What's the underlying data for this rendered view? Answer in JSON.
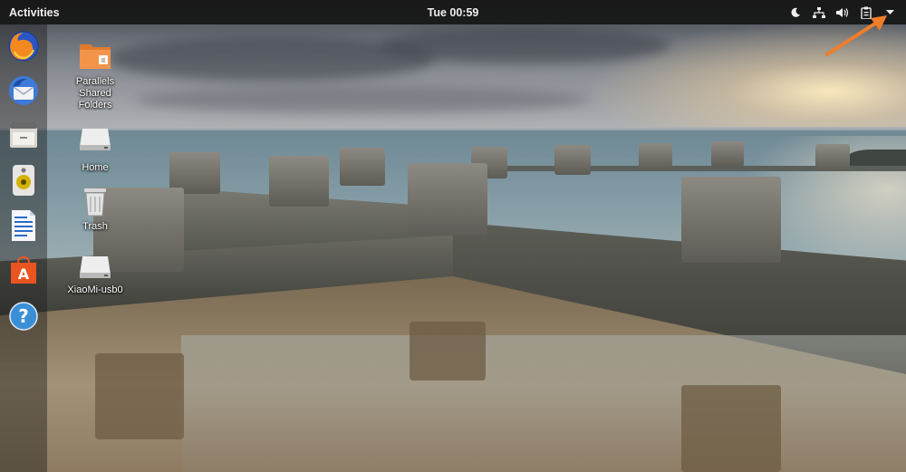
{
  "topbar": {
    "activities_label": "Activities",
    "clock": "Tue 00:59",
    "tray_icons": [
      "night-light-icon",
      "network-icon",
      "volume-icon",
      "clipboard-icon",
      "menu-arrow-icon"
    ]
  },
  "dock": {
    "items": [
      {
        "name": "firefox",
        "icon": "firefox-icon"
      },
      {
        "name": "thunderbird",
        "icon": "thunderbird-icon"
      },
      {
        "name": "files",
        "icon": "files-icon"
      },
      {
        "name": "rhythmbox",
        "icon": "speaker-icon"
      },
      {
        "name": "libreoffice-writer",
        "icon": "writer-icon"
      },
      {
        "name": "software",
        "icon": "software-icon"
      },
      {
        "name": "help",
        "icon": "help-icon"
      }
    ]
  },
  "desktop": {
    "icons": [
      {
        "label": "Parallels Shared Folders",
        "icon": "shared-folder-icon"
      },
      {
        "label": "Home",
        "icon": "home-drive-icon"
      },
      {
        "label": "Trash",
        "icon": "trash-icon"
      },
      {
        "label": "XiaoMi-usb0",
        "icon": "usb-drive-icon"
      }
    ]
  },
  "colors": {
    "topbar_bg": "#161616",
    "annotation_arrow": "#f07d2a",
    "software_orange": "#e95420",
    "help_blue": "#3a8fd6"
  }
}
